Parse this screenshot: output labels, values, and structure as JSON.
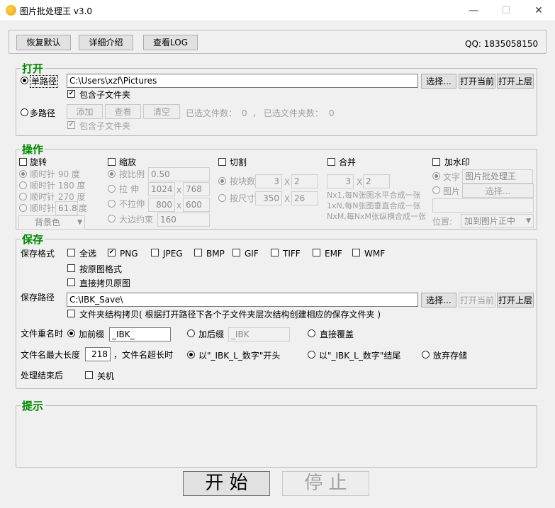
{
  "window": {
    "title": "图片批处理王 v3.0",
    "minimize": "—",
    "maximize": "☐",
    "close": "✕"
  },
  "toolbar": {
    "restore_label": "恢复默认",
    "details_label": "详细介绍",
    "log_label": "查看LOG",
    "qq": "QQ: 1835058150"
  },
  "open": {
    "legend": "打开",
    "single_path_label": "单路径",
    "path_value": "C:\\Users\\xzf\\Pictures",
    "choose_label": "选择...",
    "open_current_label": "打开当前",
    "open_parent_label": "打开上层",
    "include_sub_label": "包含子文件夹",
    "multi_path_label": "多路径",
    "add_label": "添加",
    "view_label": "查看",
    "clear_label": "清空",
    "selected_files_label": "已选文件数：",
    "selected_files_count": "0",
    "selected_folders_label": "，  已选文件夹数：",
    "selected_folders_count": "0",
    "include_sub2_label": "包含子文件夹"
  },
  "ops": {
    "legend": "操作",
    "rotate": {
      "label": "旋转",
      "cw90": "顺时针    90  度",
      "cw180": "顺时针  180  度",
      "cw270": "顺时针  270  度",
      "cw_custom": "顺时针",
      "custom_value": "61.8",
      "deg": "度",
      "bg_label": "背景色"
    },
    "scale": {
      "label": "缩放",
      "by_ratio": "按比例",
      "ratio_value": "0.50",
      "stretch": "拉    伸",
      "stretch_w": "1024",
      "stretch_h": "768",
      "no_stretch": "不拉伸",
      "nostretch_w": "800",
      "nostretch_h": "600",
      "x": "x",
      "max_constraint": "大边约束",
      "max_value": "160"
    },
    "cut": {
      "label": "切割",
      "by_blocks": "按块数",
      "blocks_a": "3",
      "blocks_b": "2",
      "by_size": "按尺寸",
      "size_a": "350",
      "size_b": "26",
      "x": "X"
    },
    "merge": {
      "label": "合并",
      "a": "3",
      "b": "2",
      "x": "X",
      "note1": "Nx1,每N张图水平合成一张",
      "note2": "1xN,每N张图垂直合成一张",
      "note3": "NxM,每NxM张纵横合成一张"
    },
    "watermark": {
      "label": "加水印",
      "text_label": "文字",
      "text_value": "图片批处理王",
      "image_label": "图片",
      "choose_label": "选择...",
      "position_label": "位置:",
      "position_value": "加到图片正中"
    }
  },
  "save": {
    "legend": "保存",
    "format_label": "保存格式",
    "formats": [
      {
        "label": "全选",
        "checked": false
      },
      {
        "label": "PNG",
        "checked": true
      },
      {
        "label": "JPEG",
        "checked": false
      },
      {
        "label": "BMP",
        "checked": false
      },
      {
        "label": "GIF",
        "checked": false
      },
      {
        "label": "TIFF",
        "checked": false
      },
      {
        "label": "EMF",
        "checked": false
      },
      {
        "label": "WMF",
        "checked": false
      }
    ],
    "by_original_label": "按原图格式",
    "direct_copy_label": "直接拷贝原图",
    "path_label": "保存路径",
    "path_value": "C:\\IBK_Save\\",
    "choose_label": "选择...",
    "open_current_label": "打开当前",
    "open_parent_label": "打开上层",
    "structure_copy_label": "文件夹结构拷贝( 根据打开路径下各个子文件夹层次结构创建相应的保存文件夹 )",
    "rename_label": "文件重名时",
    "prefix_label": "加前缀",
    "prefix_value": "_IBK_",
    "suffix_label": "加后缀",
    "suffix_value": "_IBK",
    "overwrite_label": "直接覆盖",
    "maxlen_label": "文件名最大长度",
    "maxlen_value": "218",
    "toolong_label": "，文件名超长时",
    "start_label": "以\"_IBK_L_数字\"开头",
    "end_label": "以\"_IBK_L_数字\"结尾",
    "abandon_label": "放弃存储",
    "after_label": "处理结束后",
    "shutdown_label": "关机"
  },
  "hint": {
    "legend": "提示"
  },
  "actions": {
    "start_label": "开   始",
    "stop_label": "停   止"
  }
}
